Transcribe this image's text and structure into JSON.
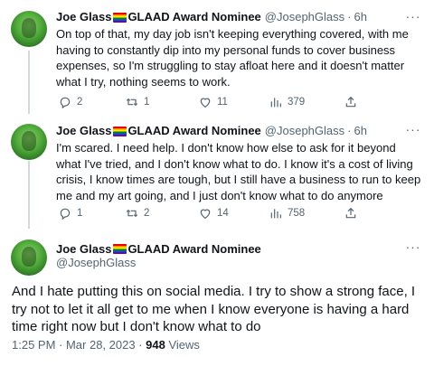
{
  "tweets": [
    {
      "name": "Joe Glass",
      "name_suffix": "GLAAD Award Nominee",
      "handle": "@JosephGlass",
      "separator": "·",
      "time": "6h",
      "text": "On top of that, my day job isn't keeping everything covered, with me having to constantly dip into my personal funds to cover business expenses, so I'm struggling to stay afloat here and it doesn't matter what I try, nothing seems to work.",
      "replies": "2",
      "retweets": "1",
      "likes": "11",
      "views": "379"
    },
    {
      "name": "Joe Glass",
      "name_suffix": "GLAAD Award Nominee",
      "handle": "@JosephGlass",
      "separator": "·",
      "time": "6h",
      "text": "I'm scared. I need help. I don't know how else to ask for it beyond what I've tried, and I don't know what to do. I know it's a cost of living crisis, I know times are tough, but I still have a business to run to keep me and my art going, and I just don't know what to do anymore",
      "replies": "1",
      "retweets": "2",
      "likes": "14",
      "views": "758"
    }
  ],
  "main_tweet": {
    "name": "Joe Glass",
    "name_suffix": "GLAAD Award Nominee",
    "handle": "@JosephGlass",
    "text": "And I hate putting this on social media. I try to show a strong face, I try not to let it all get to me when I know everyone is having a hard time right now but I don't know what to do",
    "timestamp": "1:25 PM · Mar 28, 2023 · ",
    "views_count": "948",
    "views_label": " Views"
  },
  "more_label": "···",
  "icons": {
    "reply": "reply-icon",
    "retweet": "retweet-icon",
    "like": "heart-icon",
    "views": "views-icon",
    "share": "share-icon",
    "flag": "rainbow-flag-icon"
  },
  "colors": {
    "text": "#0f1419",
    "secondary": "#536471",
    "thread_line": "#cfd9de"
  }
}
